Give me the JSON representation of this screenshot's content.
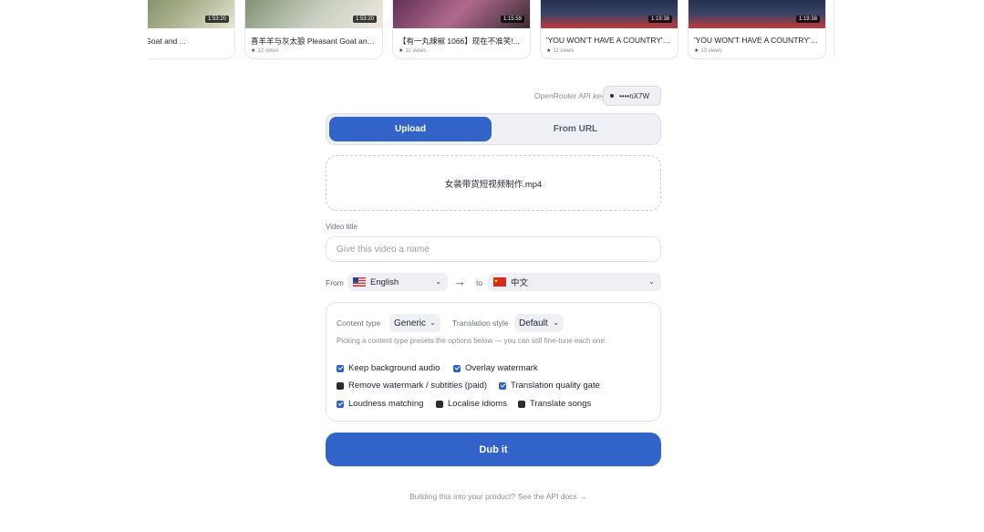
{
  "videos": [
    {
      "title": "羊 Pleasant Goat and ...",
      "duration": "1:53:20",
      "views": "",
      "thumb_color": "#6b7a4e"
    },
    {
      "title": "喜羊羊与灰太狼 Pleasant Goat and ...",
      "duration": "1:53:20",
      "views": "12 views",
      "thumb_color": "#8a8f9a"
    },
    {
      "title": "【有一丸辣椒 1066】现在不准笑!...",
      "duration": "1:15:59",
      "views": "11 views",
      "thumb_color": "#7b3a6a"
    },
    {
      "title": "'YOU WON'T HAVE A COUNTRY': Tr...",
      "duration": "1:19:38",
      "views": "11 views",
      "thumb_color": "#2a3550"
    },
    {
      "title": "'YOU WON'T HAVE A COUNTRY': Tr...",
      "duration": "1:19:38",
      "views": "13 views",
      "thumb_color": "#2a3550"
    }
  ],
  "api": {
    "label": "OpenRouter API key",
    "masked_key": "••••nX7W"
  },
  "tabs": {
    "upload": "Upload",
    "url": "From URL"
  },
  "dropzone": {
    "filename": "女装带货短视频制作.mp4"
  },
  "title_field": {
    "label": "Video title",
    "placeholder": "Give this video a name"
  },
  "language": {
    "from_label": "From",
    "from_value": "English",
    "to_label": "to",
    "to_value": "中文"
  },
  "options": {
    "content_type_label": "Content type",
    "content_type_value": "Generic",
    "style_label": "Translation style",
    "style_value": "Default",
    "hint": "Picking a content type presets the options below — you can still fine-tune each one.",
    "checks": [
      {
        "label": "Keep background audio",
        "checked": true
      },
      {
        "label": "Overlay watermark",
        "checked": true
      },
      {
        "label": "Remove watermark / subtitles (paid)",
        "checked": false
      },
      {
        "label": "Translation quality gate",
        "checked": true
      },
      {
        "label": "Loudness matching",
        "checked": true
      },
      {
        "label": "Localise idioms",
        "checked": false
      },
      {
        "label": "Translate songs",
        "checked": false
      }
    ]
  },
  "dub_button": "Dub it",
  "footer": "Building this into your product? See the API docs →",
  "colors": {
    "accent": "#3263c9",
    "muted": "#8a8f9a",
    "surface": "#eef0f5"
  }
}
